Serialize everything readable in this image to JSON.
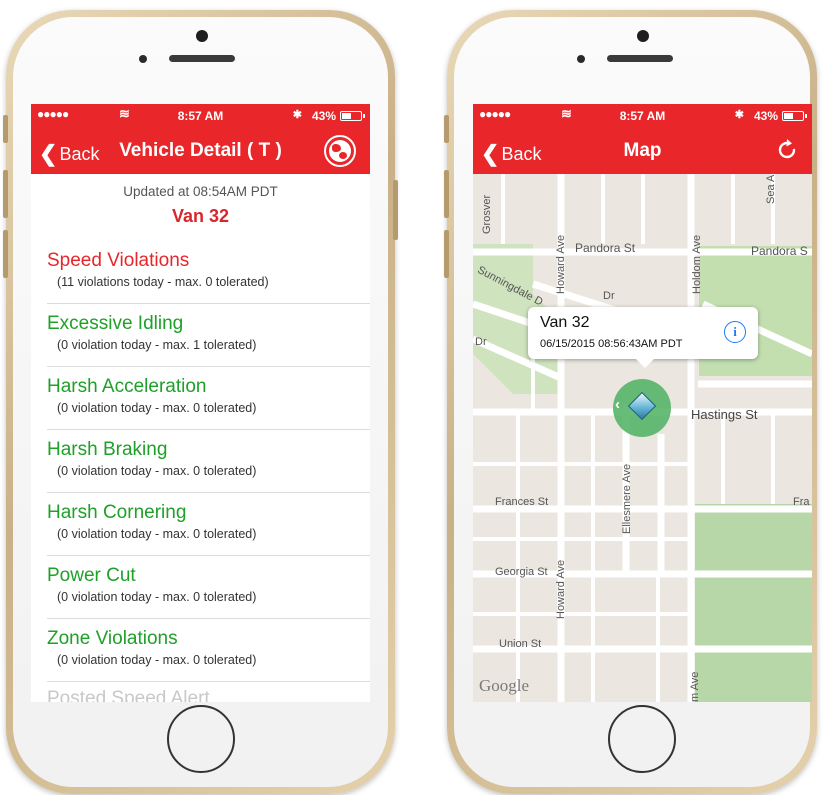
{
  "status_bar": {
    "signal": "●●●●●",
    "wifi": "≋",
    "time": "8:57 AM",
    "bluetooth": "✱",
    "battery": "43%"
  },
  "left_screen": {
    "nav": {
      "back_label": "Back",
      "title": "Vehicle Detail ( T )",
      "action_icon": "globe-icon"
    },
    "updated_text": "Updated at 08:54AM PDT",
    "vehicle_name": "Van 32",
    "violations": [
      {
        "title": "Speed Violations",
        "subtitle": "(11 violations today - max. 0 tolerated)",
        "color": "#e8262a"
      },
      {
        "title": "Excessive Idling",
        "subtitle": "(0 violation today - max. 1 tolerated)",
        "color": "#1fa028"
      },
      {
        "title": "Harsh Acceleration",
        "subtitle": "(0 violation today - max. 0 tolerated)",
        "color": "#1fa028"
      },
      {
        "title": "Harsh Braking",
        "subtitle": "(0 violation today - max. 0 tolerated)",
        "color": "#1fa028"
      },
      {
        "title": "Harsh Cornering",
        "subtitle": "(0 violation today - max. 0 tolerated)",
        "color": "#1fa028"
      },
      {
        "title": "Power Cut",
        "subtitle": "(0 violation today - max. 0 tolerated)",
        "color": "#1fa028"
      },
      {
        "title": "Zone Violations",
        "subtitle": "(0 violation today - max. 0 tolerated)",
        "color": "#1fa028"
      }
    ],
    "partial_item": "Posted Speed Alert"
  },
  "right_screen": {
    "nav": {
      "back_label": "Back",
      "title": "Map",
      "action_icon": "refresh-icon"
    },
    "callout": {
      "title": "Van 32",
      "subtitle": "06/15/2015 08:56:43AM PDT",
      "info_glyph": "i"
    },
    "streets": {
      "grosvenor": "Grosver",
      "sea": "Sea A",
      "pandora_1": "Pandora St",
      "pandora_2": "Pandora S",
      "howard_1": "Howard Ave",
      "holdom": "Holdom Ave",
      "sunningdale": "Sunningdale D",
      "dr_1": "Dr",
      "dr_2": "Dr",
      "hastings": "Hastings St",
      "ellesmere": "Ellesmere Ave",
      "frances": "Frances St",
      "fra": "Fra",
      "georgia": "Georgia St",
      "howard_2": "Howard Ave",
      "union": "Union St",
      "m_ave": "m Ave"
    },
    "map_attribution": "Google"
  },
  "colors": {
    "brand_red": "#e9262a",
    "ok_green": "#1fa028",
    "park_green": "#c3dfb0",
    "marker_green": "#4cb260"
  }
}
